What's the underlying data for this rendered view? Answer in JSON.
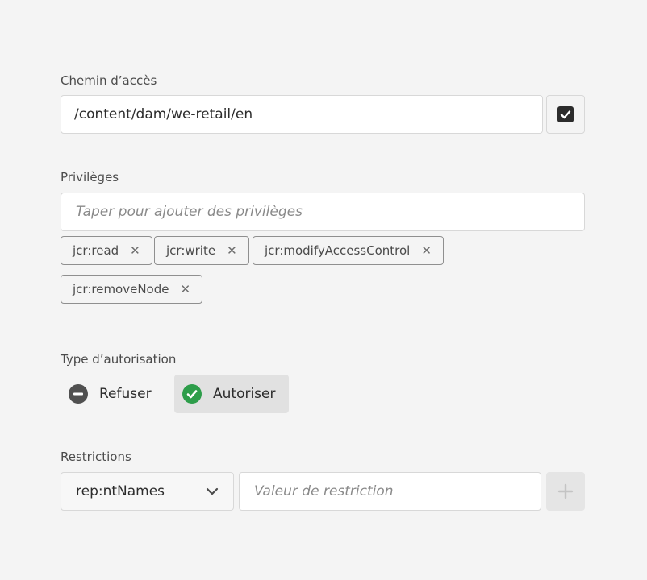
{
  "path": {
    "label": "Chemin d’accès",
    "value": "/content/dam/we-retail/en",
    "checkbox_checked": true
  },
  "privileges": {
    "label": "Privilèges",
    "placeholder": "Taper pour ajouter des privilèges",
    "tags": [
      {
        "label": "jcr:read"
      },
      {
        "label": "jcr:write"
      },
      {
        "label": "jcr:modifyAccessControl"
      },
      {
        "label": "jcr:removeNode"
      }
    ],
    "remove_icon": "close-icon"
  },
  "permission_type": {
    "label": "Type d’autorisation",
    "options": [
      {
        "label": "Refuser",
        "icon": "minus-circle-icon",
        "selected": false
      },
      {
        "label": "Autoriser",
        "icon": "check-circle-icon",
        "selected": true
      }
    ]
  },
  "restrictions": {
    "label": "Restrictions",
    "select_value": "rep:ntNames",
    "value_placeholder": "Valeur de restriction",
    "add_icon": "plus-icon"
  },
  "colors": {
    "background": "#f4f4f4",
    "deny_icon": "#505050",
    "allow_icon": "#2d9d4a",
    "selected_bg": "#e1e1e1"
  }
}
